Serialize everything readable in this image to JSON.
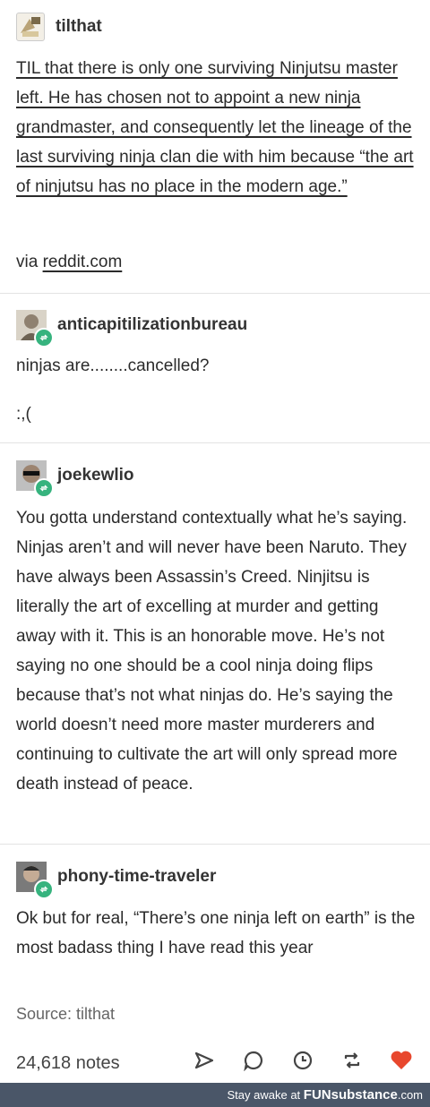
{
  "post1": {
    "username": "tilthat",
    "text": "TIL that there is only one surviving Ninjutsu master left. He has chosen not to appoint a new ninja grandmaster, and consequently let the lineage of the last surviving ninja clan die with him because “the art of ninjutsu has no place in the modern age.”",
    "via_prefix": "via ",
    "via_link": "reddit.com"
  },
  "post2": {
    "username": "anticapitilizationbureau",
    "line1": "ninjas are........cancelled?",
    "line2": ":,("
  },
  "post3": {
    "username": "joekewlio",
    "text": "You gotta understand contextually what he’s saying. Ninjas aren’t and will never have been Naruto. They have always been Assassin’s Creed. Ninjitsu is literally the art of excelling at murder and getting away with it. This is an honorable move. He’s not saying no one should be a cool ninja doing flips because that’s not what ninjas do. He’s saying the world doesn’t need more master murderers and continuing to cultivate the art will only spread more death instead of peace."
  },
  "post4": {
    "username": "phony-time-traveler",
    "text": "Ok but for real, “There’s one ninja left on earth” is the most badass thing I have read this year"
  },
  "source": "Source: tilthat",
  "notes": "24,618 notes",
  "actions": [
    "share-icon",
    "comment-icon",
    "clock-icon",
    "reblog-icon",
    "heart-icon"
  ],
  "footer": {
    "prefix": "Stay awake at ",
    "brand": "FUNsubstance",
    "suffix": ".com"
  },
  "colors": {
    "heart": "#e8472d",
    "reblog_badge": "#36b37e",
    "footer_bg": "#4a5668"
  }
}
